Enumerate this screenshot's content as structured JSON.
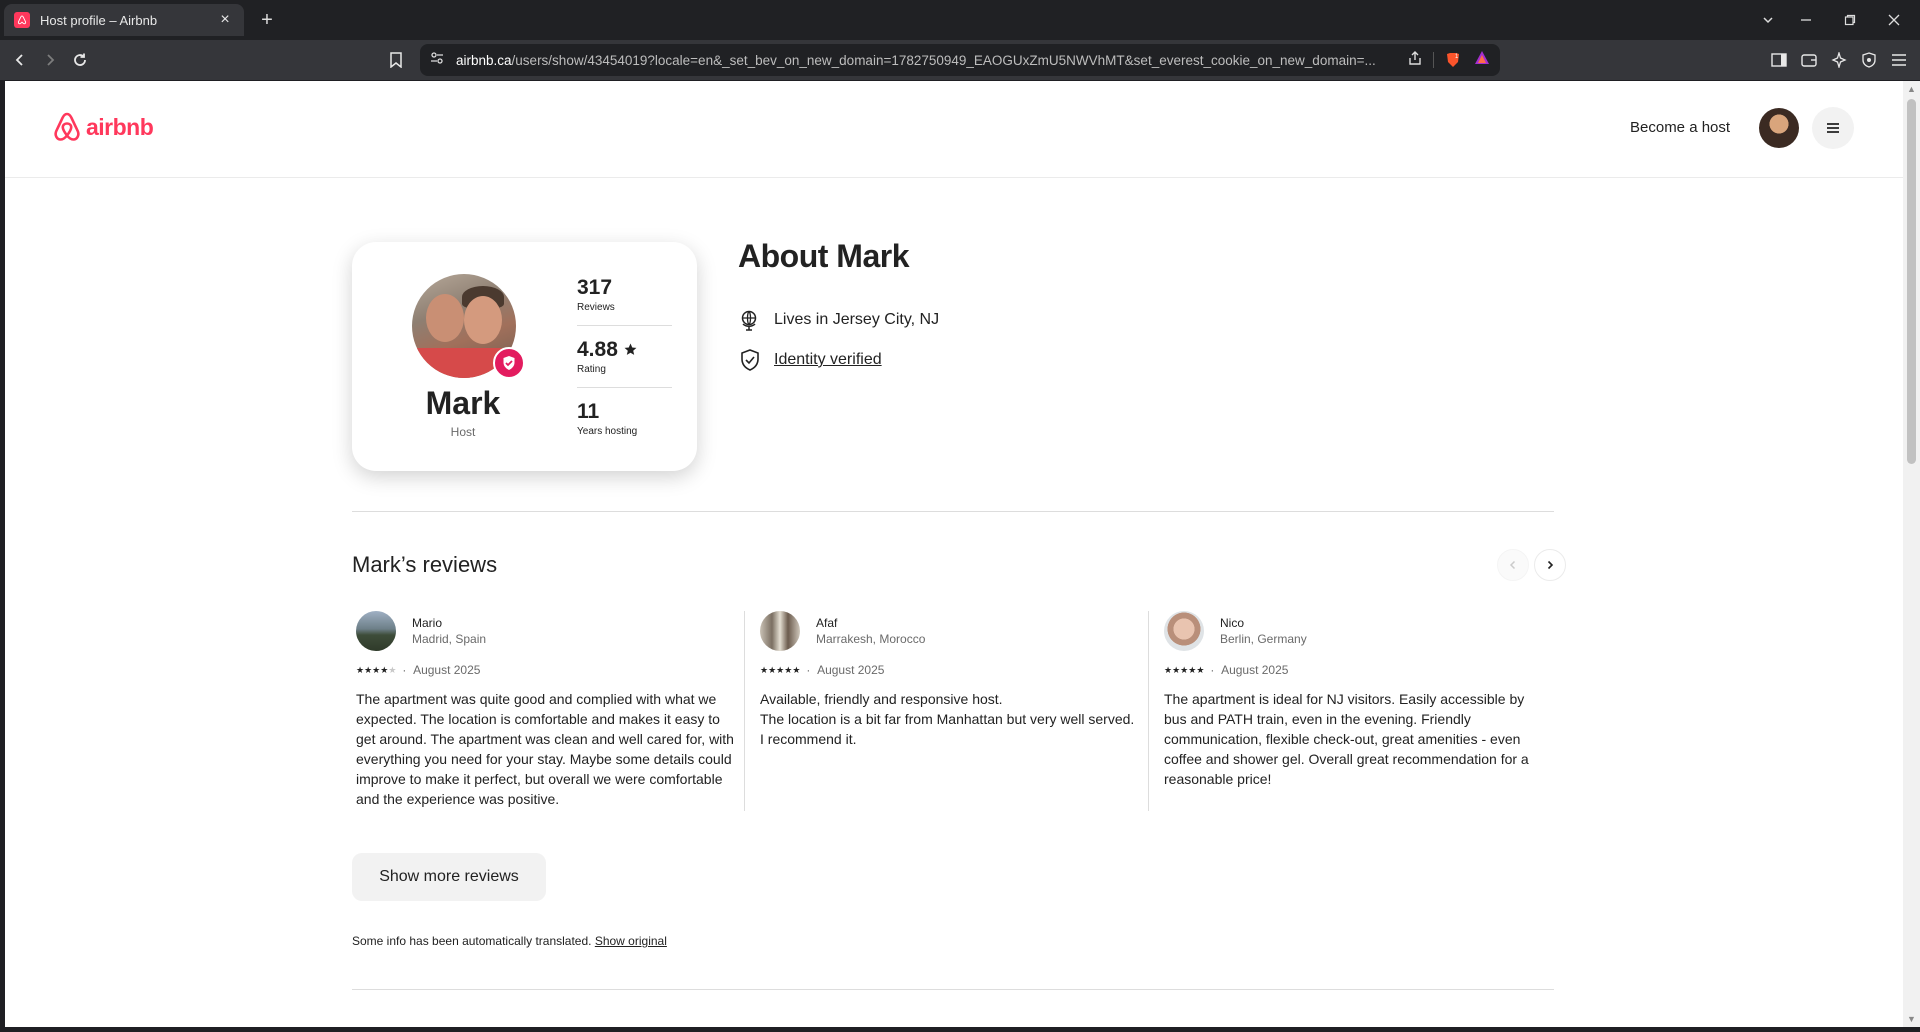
{
  "browser": {
    "tab_title": "Host profile – Airbnb",
    "url_host": "airbnb.ca",
    "url_rest": "/users/show/43454019?locale=en&_set_bev_on_new_domain=1782750949_EAOGUxZmU5NWVhMT&set_everest_cookie_on_new_domain=..."
  },
  "header": {
    "logo_text": "airbnb",
    "become_host": "Become a host"
  },
  "profile": {
    "name": "Mark",
    "role": "Host",
    "stats": [
      {
        "value": "317",
        "label": "Reviews"
      },
      {
        "value": "4.88",
        "label": "Rating"
      },
      {
        "value": "11",
        "label": "Years hosting"
      }
    ]
  },
  "about": {
    "title": "About Mark",
    "lives_in": "Lives in Jersey City, NJ",
    "identity": "Identity verified"
  },
  "reviews": {
    "title": "Mark’s reviews",
    "items": [
      {
        "name": "Mario",
        "location": "Madrid, Spain",
        "rating": 4,
        "date": "August 2025",
        "text": "The apartment was quite good and complied with what we expected. The location is comfortable and makes it easy to get around. The apartment was clean and well cared for, with everything you need for your stay. Maybe some details could improve to make it perfect, but overall we were comfortable and the experience was positive."
      },
      {
        "name": "Afaf",
        "location": "Marrakesh, Morocco",
        "rating": 5,
        "date": "August 2025",
        "text": "Available, friendly and responsive host.\nThe location is a bit far from Manhattan but very well served.\nI recommend it."
      },
      {
        "name": "Nico",
        "location": "Berlin, Germany",
        "rating": 5,
        "date": "August 2025",
        "text": "The apartment is ideal for NJ visitors. Easily accessible by bus and PATH train, even in the evening. Friendly communication, flexible check-out, great amenities - even coffee and shower gel. Overall great recommendation for a reasonable price!"
      }
    ],
    "show_more": "Show more reviews",
    "date_separator": "·"
  },
  "translation": {
    "note": "Some info has been automatically translated.",
    "link": "Show original"
  },
  "colors": {
    "brand": "#ff385c",
    "badge": "#e31c5f"
  }
}
